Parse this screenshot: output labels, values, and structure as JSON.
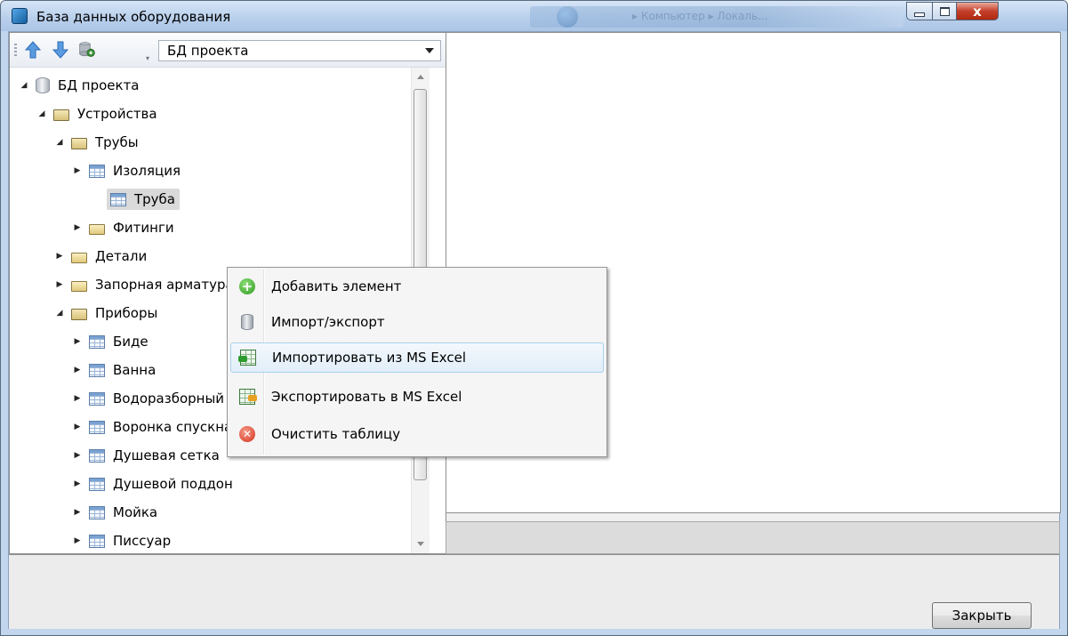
{
  "window": {
    "title": "База данных оборудования",
    "close_glyph": "x"
  },
  "background_window": {
    "breadcrumb": "▸ Компьютер ▸ Локаль..."
  },
  "toolbar": {
    "icons": [
      "arrow-up-icon",
      "arrow-down-icon",
      "database-settings-icon"
    ],
    "database_combo": {
      "selected": "БД проекта"
    }
  },
  "tree": {
    "items": [
      {
        "label": "БД проекта",
        "icon": "database-icon",
        "expanded": true
      },
      {
        "label": "Устройства",
        "icon": "folder-open-icon",
        "expanded": true
      },
      {
        "label": "Трубы",
        "icon": "folder-open-icon",
        "expanded": true
      },
      {
        "label": "Изоляция",
        "icon": "table-icon",
        "expanded": false
      },
      {
        "label": "Труба",
        "icon": "table-icon",
        "selected": true
      },
      {
        "label": "Фитинги",
        "icon": "folder-icon",
        "expanded": false
      },
      {
        "label": "Детали",
        "icon": "folder-icon",
        "expanded": false
      },
      {
        "label": "Запорная арматура",
        "icon": "folder-icon",
        "expanded": false
      },
      {
        "label": "Приборы",
        "icon": "folder-open-icon",
        "expanded": true
      },
      {
        "label": "Биде",
        "icon": "table-icon",
        "expanded": false
      },
      {
        "label": "Ванна",
        "icon": "table-icon",
        "expanded": false
      },
      {
        "label": "Водоразборный кран",
        "icon": "table-icon",
        "expanded": false
      },
      {
        "label": "Воронка спускная",
        "icon": "table-icon",
        "expanded": false
      },
      {
        "label": "Душевая сетка",
        "icon": "table-icon",
        "expanded": false
      },
      {
        "label": "Душевой поддон",
        "icon": "table-icon",
        "expanded": false
      },
      {
        "label": "Мойка",
        "icon": "table-icon",
        "expanded": false
      },
      {
        "label": "Писсуар",
        "icon": "table-icon",
        "expanded": false
      }
    ]
  },
  "context_menu": {
    "items": [
      {
        "label": "Добавить элемент",
        "icon": "add-icon"
      },
      {
        "label": "Импорт/экспорт",
        "icon": "database-icon"
      },
      {
        "label": "Импортировать из MS Excel",
        "icon": "excel-import-icon",
        "highlighted": true
      },
      {
        "label": "Экспортировать в MS Excel",
        "icon": "excel-export-icon"
      },
      {
        "label": "Очистить таблицу",
        "icon": "delete-icon"
      }
    ]
  },
  "footer": {
    "close_button": "Закрыть"
  },
  "colors": {
    "title_bar": "#b9d0ec",
    "menu_highlight": "#e2eef9",
    "selection": "#dadada",
    "close_button_red": "#c4402a"
  }
}
